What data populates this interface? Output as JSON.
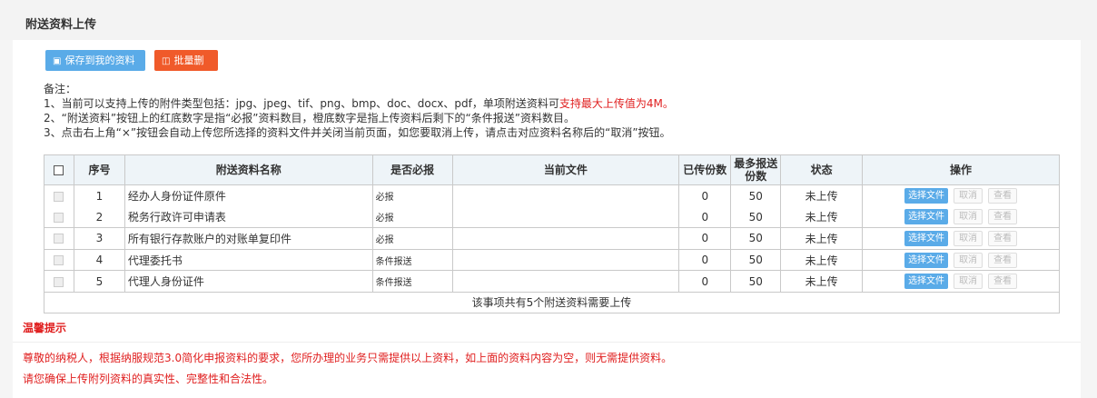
{
  "page_title": "附送资料上传",
  "toolbar": {
    "save_label": "保存到我的资料库",
    "delete_label": "批量删除"
  },
  "notes": {
    "heading": "备注：",
    "line1_prefix": "1、当前可以支持上传的附件类型包括：jpg、jpeg、tif、png、bmp、doc、docx、pdf，单项附送资料可",
    "line1_highlight": "支持最大上传值为4M。",
    "line2": "2、“附送资料”按钮上的红底数字是指“必报”资料数目，橙底数字是指上传资料后剩下的“条件报送”资料数目。",
    "line3": "3、点击右上角“×”按钮会自动上传您所选择的资料文件并关闭当前页面，如您要取消上传，请点击对应资料名称后的“取消”按钮。"
  },
  "table": {
    "headers": {
      "index": "序号",
      "name": "附送资料名称",
      "required": "是否必报",
      "file": "当前文件",
      "uploaded": "已传份数",
      "max": "最多报送份数",
      "status": "状态",
      "action": "操作"
    },
    "rows": [
      {
        "index": "1",
        "name": "经办人身份证件原件",
        "required": "必报",
        "file": "",
        "uploaded": "0",
        "max": "50",
        "status": "未上传",
        "choose": "选择文件",
        "cancel": "取消",
        "view": "查看"
      },
      {
        "index": "2",
        "name": "税务行政许可申请表",
        "required": "必报",
        "file": "",
        "uploaded": "0",
        "max": "50",
        "status": "未上传",
        "choose": "选择文件",
        "cancel": "取消",
        "view": "查看"
      },
      {
        "index": "3",
        "name": "所有银行存款账户的对账单复印件",
        "required": "必报",
        "file": "",
        "uploaded": "0",
        "max": "50",
        "status": "未上传",
        "choose": "选择文件",
        "cancel": "取消",
        "view": "查看"
      },
      {
        "index": "4",
        "name": "代理委托书",
        "required": "条件报送",
        "file": "",
        "uploaded": "0",
        "max": "50",
        "status": "未上传",
        "choose": "选择文件",
        "cancel": "取消",
        "view": "查看"
      },
      {
        "index": "5",
        "name": "代理人身份证件",
        "required": "条件报送",
        "file": "",
        "uploaded": "0",
        "max": "50",
        "status": "未上传",
        "choose": "选择文件",
        "cancel": "取消",
        "view": "查看"
      }
    ],
    "footer": "该事项共有5个附送资料需要上传"
  },
  "tips": {
    "title": "温馨提示",
    "line1": "尊敬的纳税人，根据纳服规范3.0简化申报资料的要求，您所办理的业务只需提供以上资料，如上面的资料内容为空，则无需提供资料。",
    "line2": "请您确保上传附列资料的真实性、完整性和合法性。"
  },
  "colors": {
    "accent_blue": "#5aabe8",
    "danger_orange": "#f05a2a",
    "warning_red": "#e02020"
  },
  "icons": {
    "save": "save-icon",
    "delete": "trash-icon"
  }
}
